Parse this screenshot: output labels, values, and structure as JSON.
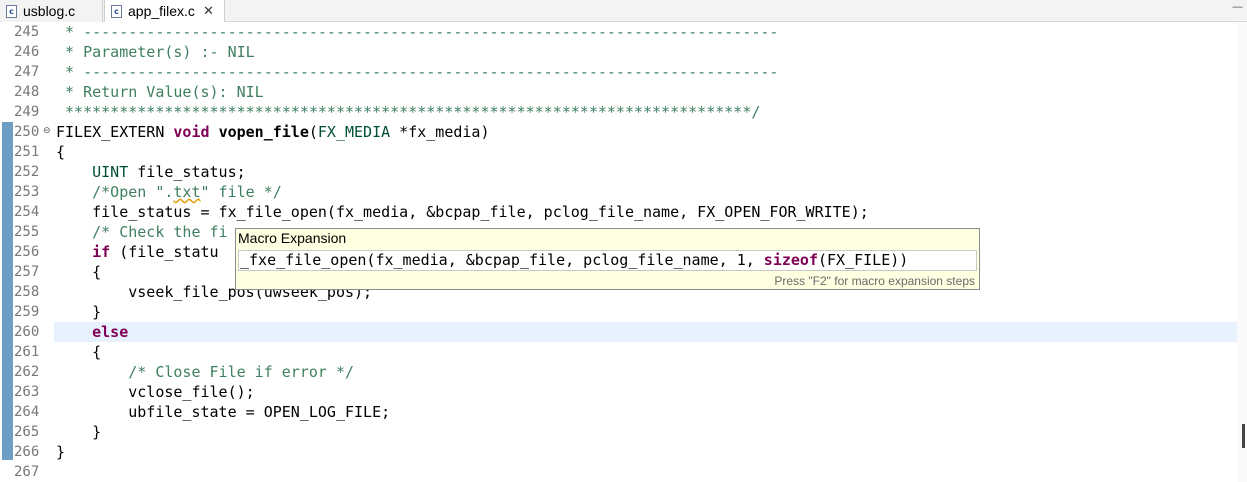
{
  "tabs": [
    {
      "label": "usblog.c",
      "active": false
    },
    {
      "label": "app_filex.c",
      "active": true,
      "close": "✕"
    }
  ],
  "icons": {
    "file": "c-source-file-icon",
    "fold": "fold-collapse-icon"
  },
  "colors": {
    "comment": "#3f7f5f",
    "keyword": "#7f0055",
    "change_bar": "#6e9ec4",
    "popup_bg": "#ffffe1",
    "current_line": "#e8f2fe"
  },
  "editor": {
    "lines": [
      {
        "n": "245",
        "t": " * -----------------------------------------------------------------------------"
      },
      {
        "n": "246",
        "t": " * Parameter(s) :- NIL"
      },
      {
        "n": "247",
        "t": " * -----------------------------------------------------------------------------"
      },
      {
        "n": "248",
        "t": " * Return Value(s): NIL"
      },
      {
        "n": "249",
        "t": " ****************************************************************************/"
      },
      {
        "n": "250",
        "t": "FILEX_EXTERN void vopen_file(FX_MEDIA *fx_media)"
      },
      {
        "n": "251",
        "t": "{"
      },
      {
        "n": "252",
        "t": "    UINT file_status;"
      },
      {
        "n": "253",
        "t": "    /*Open \".txt\" file */"
      },
      {
        "n": "254",
        "t": "    file_status = fx_file_open(fx_media, &bcpap_file, pclog_file_name, FX_OPEN_FOR_WRITE);"
      },
      {
        "n": "255",
        "t": "    /* Check the fi"
      },
      {
        "n": "256",
        "t": "    if (file_statu"
      },
      {
        "n": "257",
        "t": "    {"
      },
      {
        "n": "258",
        "t": "        vseek_file_pos(uwseek_pos);"
      },
      {
        "n": "259",
        "t": "    }"
      },
      {
        "n": "260",
        "t": "    else"
      },
      {
        "n": "261",
        "t": "    {"
      },
      {
        "n": "262",
        "t": "        /* Close File if error */"
      },
      {
        "n": "263",
        "t": "        vclose_file();"
      },
      {
        "n": "264",
        "t": "        ubfile_state = OPEN_LOG_FILE;"
      },
      {
        "n": "265",
        "t": "    }"
      },
      {
        "n": "266",
        "t": "}"
      },
      {
        "n": "267",
        "t": ""
      }
    ]
  },
  "popup": {
    "title": "Macro Expansion",
    "code_pre": "_fxe_file_open(fx_media, &bcpap_file, pclog_file_name, 1, ",
    "code_kw": "sizeof",
    "code_post": "(FX_FILE))",
    "hint": "Press \"F2\" for macro expansion steps"
  }
}
